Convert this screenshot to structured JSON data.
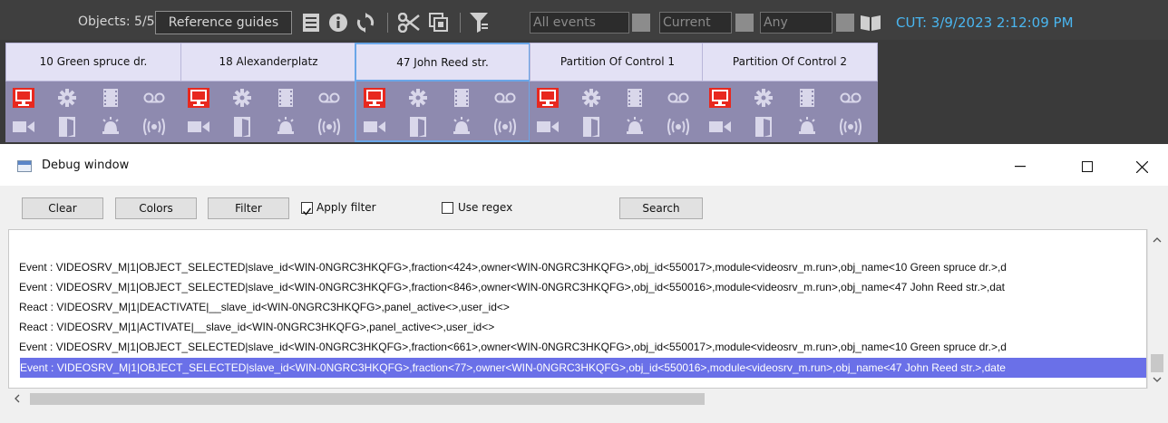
{
  "toolbar": {
    "objects_label": "Objects: 5/5",
    "reference_guides_label": "Reference guides",
    "events_field": "All events",
    "current_field": "Current",
    "any_field": "Any",
    "cut_label": "CUT: 3/9/2023 2:12:09 PM"
  },
  "panels": [
    {
      "title": "10 Green spruce dr."
    },
    {
      "title": "18 Alexanderplatz"
    },
    {
      "title": "47 John Reed str."
    },
    {
      "title": "Partition  Of Control 1"
    },
    {
      "title": "Partition  Of Control 2"
    }
  ],
  "debug": {
    "title": "Debug window",
    "buttons": {
      "clear": "Clear",
      "colors": "Colors",
      "filter": "Filter",
      "search": "Search"
    },
    "apply_filter_label": "Apply filter",
    "apply_filter_checked": true,
    "use_regex_label": "Use regex",
    "use_regex_checked": false,
    "log_lines": [
      "Event : VIDEOSRV_M|1|OBJECT_SELECTED|slave_id<WIN-0NGRC3HKQFG>,fraction<424>,owner<WIN-0NGRC3HKQFG>,obj_id<550017>,module<videosrv_m.run>,obj_name<10 Green spruce dr.>,d",
      "Event : VIDEOSRV_M|1|OBJECT_SELECTED|slave_id<WIN-0NGRC3HKQFG>,fraction<846>,owner<WIN-0NGRC3HKQFG>,obj_id<550016>,module<videosrv_m.run>,obj_name<47 John Reed str.>,dat",
      "React : VIDEOSRV_M|1|DEACTIVATE|__slave_id<WIN-0NGRC3HKQFG>,panel_active<>,user_id<>",
      "React : VIDEOSRV_M|1|ACTIVATE|__slave_id<WIN-0NGRC3HKQFG>,panel_active<>,user_id<>",
      "Event : VIDEOSRV_M|1|OBJECT_SELECTED|slave_id<WIN-0NGRC3HKQFG>,fraction<661>,owner<WIN-0NGRC3HKQFG>,obj_id<550017>,module<videosrv_m.run>,obj_name<10 Green spruce dr.>,d",
      "Event : VIDEOSRV_M|1|OBJECT_SELECTED|slave_id<WIN-0NGRC3HKQFG>,fraction<77>,owner<WIN-0NGRC3HKQFG>,obj_id<550016>,module<videosrv_m.run>,obj_name<47 John Reed str.>,date"
    ]
  },
  "colors": {
    "panel_title_bg": "#e3e1f5",
    "panel_body_bg": "#8e8aaf",
    "alert_red": "#e8281e",
    "selection": "#6a70e8",
    "cut_blue": "#4ab6f0"
  }
}
